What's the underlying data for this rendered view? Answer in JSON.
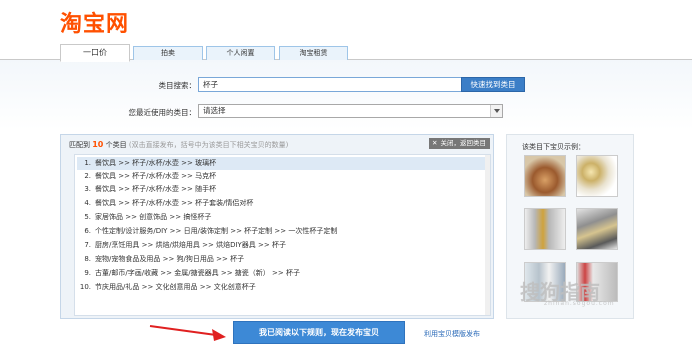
{
  "logo": "淘宝网",
  "tabs": [
    "一口价",
    "拍卖",
    "个人闲置",
    "淘宝租赁"
  ],
  "search": {
    "label": "类目搜索：",
    "value": "杯子",
    "button": "快速找到类目"
  },
  "recent": {
    "label": "您最近使用的类目：",
    "selected": "请选择"
  },
  "results": {
    "prefix": "匹配到",
    "count": "10",
    "suffix": "个类目",
    "hint": "(双击直接发布，括号中为该类目下相关宝贝的数量)",
    "close_label": "关闭，返回类目",
    "items": [
      {
        "num": "1.",
        "path": "餐饮具 >> 杯子/水杯/水壶 >> 玻璃杯"
      },
      {
        "num": "2.",
        "path": "餐饮具 >> 杯子/水杯/水壶 >> 马克杯"
      },
      {
        "num": "3.",
        "path": "餐饮具 >> 杯子/水杯/水壶 >> 随手杯"
      },
      {
        "num": "4.",
        "path": "餐饮具 >> 杯子/水杯/水壶 >> 杯子套装/情侣对杯"
      },
      {
        "num": "5.",
        "path": "家居饰品 >> 创意饰品 >> 搞怪杯子"
      },
      {
        "num": "6.",
        "path": "个性定制/设计服务/DIY >> 日用/装饰定制 >> 杯子定制 >> 一次性杯子定制"
      },
      {
        "num": "7.",
        "path": "厨房/烹饪用具 >> 烘焙/烘焙用具 >> 烘焙DIY器具 >> 杯子"
      },
      {
        "num": "8.",
        "path": "宠物/宠物食品及用品 >> 狗/狗日用品 >> 杯子"
      },
      {
        "num": "9.",
        "path": "古董/邮币/字画/收藏 >> 金属/搪瓷器具 >> 搪瓷（新） >> 杯子"
      },
      {
        "num": "10.",
        "path": "节庆用品/礼品 >> 文化创意用品 >> 文化创意杯子"
      }
    ]
  },
  "samples": {
    "title": "该类目下宝贝示例：",
    "thumbs": [
      "glass-cup-photo-1",
      "glass-cup-photo-2",
      "glass-cup-photo-3",
      "glass-cup-photo-4",
      "glass-cup-photo-5",
      "glass-cup-photo-6"
    ]
  },
  "publish_button": "我已阅读以下规则，现在发布宝贝",
  "template_link": "利用宝贝模版发布",
  "watermark": "搜狗指南",
  "watermark_sub": "zhinan.sogou.com",
  "colors": {
    "brand": "#ff5000",
    "accent": "#3d89d6",
    "count": "#ff5000"
  }
}
